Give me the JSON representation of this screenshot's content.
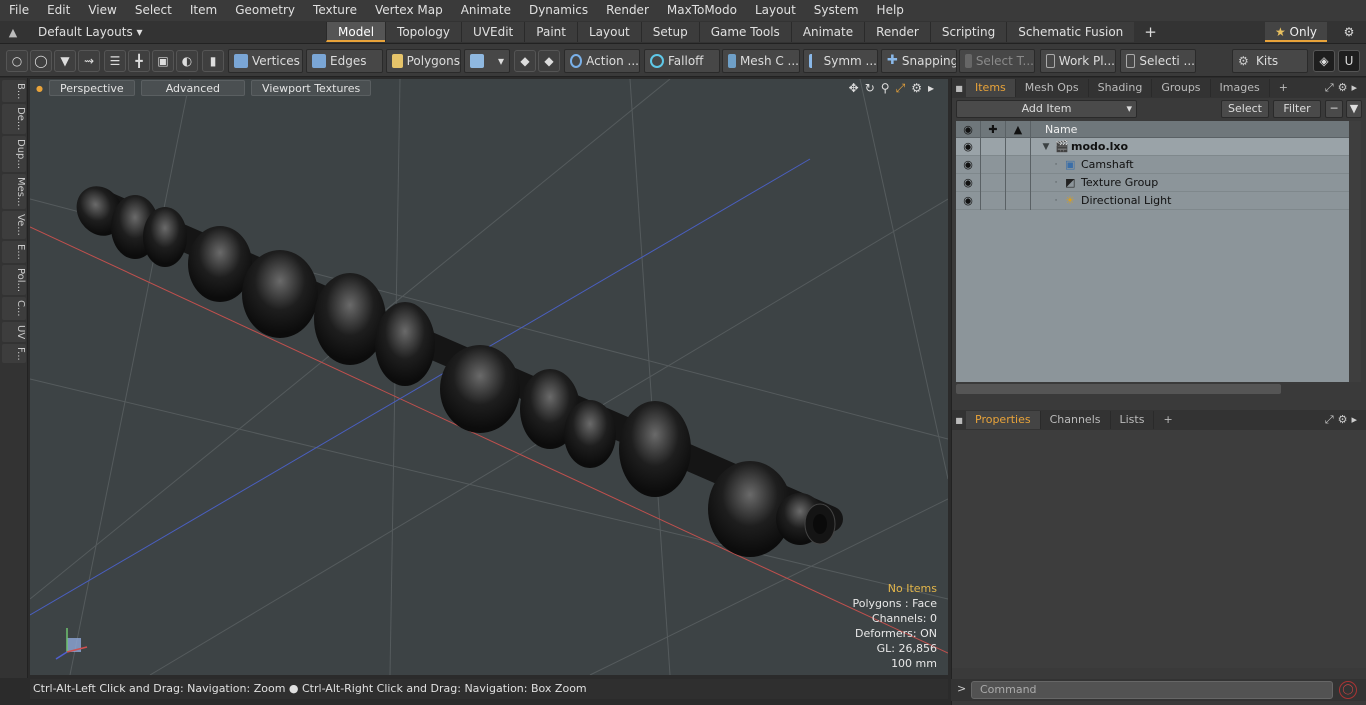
{
  "menu": [
    "File",
    "Edit",
    "View",
    "Select",
    "Item",
    "Geometry",
    "Texture",
    "Vertex Map",
    "Animate",
    "Dynamics",
    "Render",
    "MaxToModo",
    "Layout",
    "System",
    "Help"
  ],
  "layouts_label": "Default Layouts",
  "layout_tabs": [
    "Model",
    "Topology",
    "UVEdit",
    "Paint",
    "Layout",
    "Setup",
    "Game Tools",
    "Animate",
    "Render",
    "Scripting",
    "Schematic Fusion"
  ],
  "active_layout_tab": "Model",
  "only_label": "Only",
  "toolbar": {
    "vertices": "Vertices",
    "edges": "Edges",
    "polygons": "Polygons",
    "action": "Action ...",
    "falloff": "Falloff",
    "mesh_c": "Mesh C ...",
    "symm": "Symm ...",
    "snapping": "Snapping",
    "select_t": "Select T...",
    "work_pl": "Work Pl...",
    "selecti": "Selecti ...",
    "kits": "Kits"
  },
  "left_tabs": [
    "B...",
    "De...",
    "Dup...",
    "Mes...",
    "Ve...",
    "E...",
    "Pol...",
    "C...",
    "UV",
    "F..."
  ],
  "viewport": {
    "perspective": "Perspective",
    "advanced": "Advanced",
    "viewport_textures": "Viewport Textures",
    "info": {
      "no_items": "No Items",
      "polygons": "Polygons : Face",
      "channels": "Channels: 0",
      "deformers": "Deformers: ON",
      "gl": "GL: 26,856",
      "scale": "100 mm"
    }
  },
  "status_text": "Ctrl-Alt-Left Click and Drag: Navigation: Zoom ● Ctrl-Alt-Right Click and Drag: Navigation: Box Zoom",
  "items_panel": {
    "tabs": [
      "Items",
      "Mesh Ops",
      "Shading",
      "Groups",
      "Images"
    ],
    "active_tab": "Items",
    "add_item": "Add Item",
    "select": "Select",
    "filter": "Filter",
    "column_name": "Name",
    "rows": [
      {
        "name": "modo.lxo",
        "icon": "scene-icon",
        "bold": true
      },
      {
        "name": "Camshaft",
        "icon": "mesh-icon",
        "bold": false
      },
      {
        "name": "Texture Group",
        "icon": "texture-group-icon",
        "bold": false
      },
      {
        "name": "Directional Light",
        "icon": "light-icon",
        "bold": false
      }
    ]
  },
  "properties_panel": {
    "tabs": [
      "Properties",
      "Channels",
      "Lists"
    ],
    "active_tab": "Properties"
  },
  "command_placeholder": "Command",
  "colors": {
    "accent": "#e8a33a",
    "viewport_bg": "#3d4345",
    "x_axis": "#c0504d",
    "z_axis": "#4a5fc0",
    "items_bg": "#8c959a"
  }
}
